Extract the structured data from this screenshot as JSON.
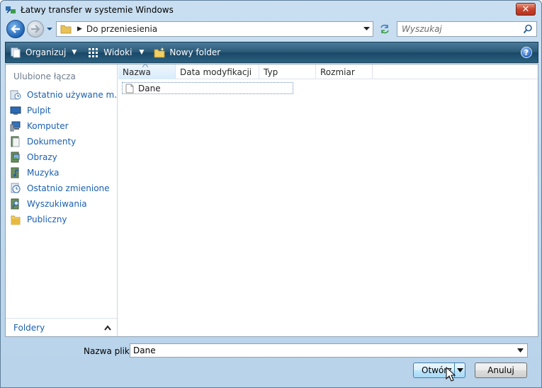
{
  "window": {
    "title": "Łatwy transfer w systemie Windows",
    "close_label": "✕"
  },
  "navigation": {
    "address_path": "Do przeniesienia",
    "search_placeholder": "Wyszukaj"
  },
  "toolbar": {
    "organize_label": "Organizuj",
    "views_label": "Widoki",
    "new_folder_label": "Nowy folder",
    "help_label": "?"
  },
  "sidebar": {
    "favorites_title": "Ulubione łącza",
    "items": [
      {
        "label": "Ostatnio używane m...",
        "icon": "recent-places-icon"
      },
      {
        "label": "Pulpit",
        "icon": "desktop-icon"
      },
      {
        "label": "Komputer",
        "icon": "computer-icon"
      },
      {
        "label": "Dokumenty",
        "icon": "documents-icon"
      },
      {
        "label": "Obrazy",
        "icon": "pictures-icon"
      },
      {
        "label": "Muzyka",
        "icon": "music-icon"
      },
      {
        "label": "Ostatnio zmienione",
        "icon": "recently-changed-icon"
      },
      {
        "label": "Wyszukiwania",
        "icon": "searches-icon"
      },
      {
        "label": "Publiczny",
        "icon": "public-folder-icon"
      }
    ],
    "folders_label": "Foldery"
  },
  "file_list": {
    "columns": [
      "Nazwa",
      "Data modyfikacji",
      "Typ",
      "Rozmiar"
    ],
    "rows": [
      {
        "name": "Dane"
      }
    ]
  },
  "footer": {
    "filename_label": "Nazwa pliku:",
    "filename_value": "Dane",
    "open_label": "Otwórz",
    "cancel_label": "Anuluj"
  }
}
